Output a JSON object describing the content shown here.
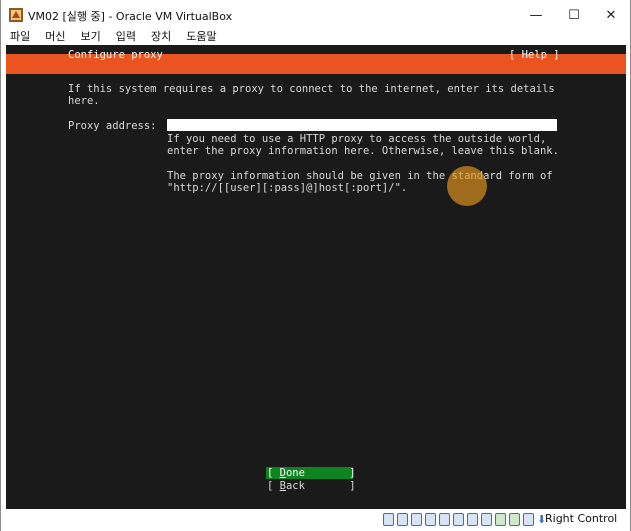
{
  "window": {
    "title": "VM02 [실행 중] - Oracle VM VirtualBox",
    "controls": {
      "minimize": "—",
      "maximize": "☐",
      "close": "✕"
    }
  },
  "menubar": {
    "items": [
      "파일",
      "머신",
      "보기",
      "입력",
      "장치",
      "도움말"
    ]
  },
  "installer": {
    "header_title": "Configure proxy",
    "help_label": "[ Help ]",
    "intro_line1": "If this system requires a proxy to connect to the internet, enter its details",
    "intro_line2": "here.",
    "proxy_label": "Proxy address:",
    "proxy_value": "",
    "help_line1": "If you need to use a HTTP proxy to access the outside world,",
    "help_line2": "enter the proxy information here. Otherwise, leave this blank.",
    "help_line3": "The proxy information should be given in the standard form of",
    "help_line4": "\"http://[[user][:pass]@]host[:port]/\".",
    "done_button": "[ Done       ]",
    "back_button": "[ Back       ]"
  },
  "statusbar": {
    "host_key": "Right Control"
  },
  "colors": {
    "header_orange": "#e95420",
    "done_green": "#0e8420",
    "screen_bg": "#1a1a1a"
  }
}
